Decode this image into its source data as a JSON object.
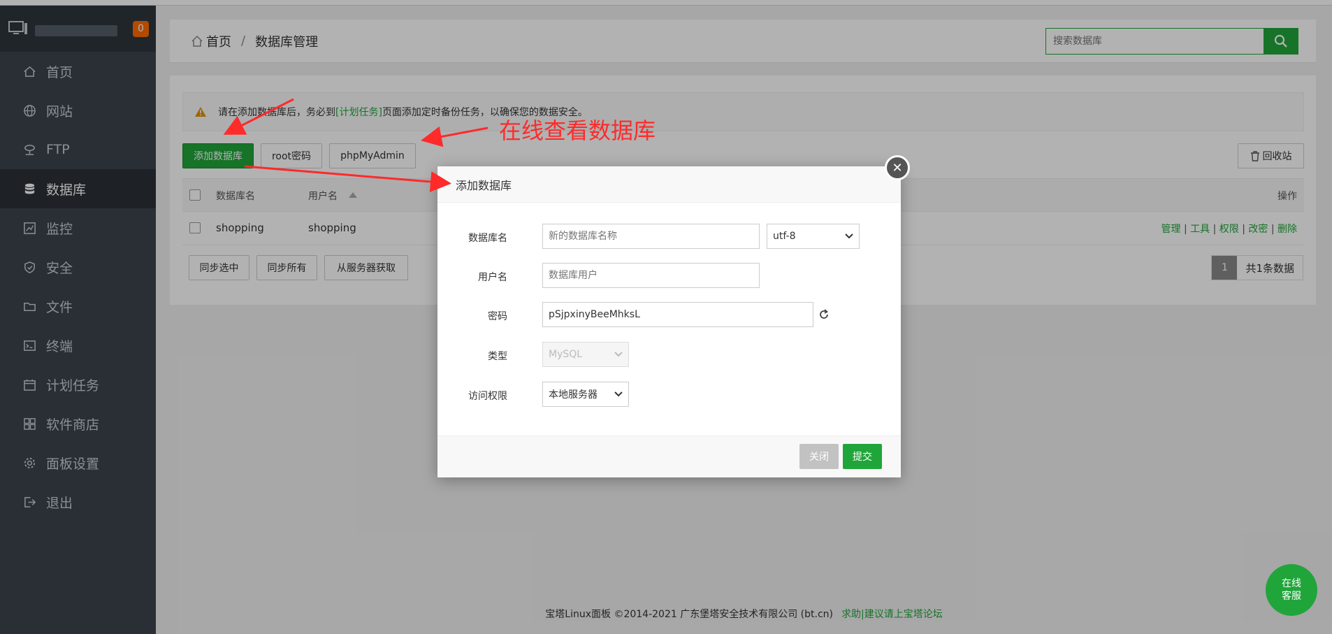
{
  "sidebar": {
    "badge": "0",
    "items": [
      {
        "label": "首页",
        "icon": "home-icon"
      },
      {
        "label": "网站",
        "icon": "globe-icon"
      },
      {
        "label": "FTP",
        "icon": "ftp-icon"
      },
      {
        "label": "数据库",
        "icon": "database-icon"
      },
      {
        "label": "监控",
        "icon": "monitor-chart-icon"
      },
      {
        "label": "安全",
        "icon": "shield-icon"
      },
      {
        "label": "文件",
        "icon": "folder-icon"
      },
      {
        "label": "终端",
        "icon": "terminal-icon"
      },
      {
        "label": "计划任务",
        "icon": "calendar-icon"
      },
      {
        "label": "软件商店",
        "icon": "grid-icon"
      },
      {
        "label": "面板设置",
        "icon": "gear-icon"
      },
      {
        "label": "退出",
        "icon": "logout-icon"
      }
    ]
  },
  "breadcrumb": {
    "home": "首页",
    "sep": "/",
    "current": "数据库管理"
  },
  "search": {
    "placeholder": "搜索数据库"
  },
  "notice": {
    "before": "请在添加数据库后，务必到",
    "link": "[计划任务]",
    "after": "页面添加定时备份任务，以确保您的数据安全。"
  },
  "toolbar": {
    "add_db": "添加数据库",
    "root_pwd": "root密码",
    "phpmyadmin": "phpMyAdmin",
    "recycle": "回收站"
  },
  "table": {
    "headers": {
      "name": "数据库名",
      "user": "用户名",
      "ops": "操作"
    },
    "rows": [
      {
        "name": "shopping",
        "user": "shopping"
      }
    ],
    "ops": [
      "管理",
      "工具",
      "权限",
      "改密",
      "删除"
    ]
  },
  "bottom": {
    "sync_selected": "同步选中",
    "sync_all": "同步所有",
    "from_server": "从服务器获取"
  },
  "pager": {
    "page": "1",
    "total": "共1条数据"
  },
  "footer": {
    "copyright": "宝塔Linux面板 ©2014-2021 广东堡塔安全技术有限公司 (bt.cn)",
    "link": "求助|建议请上宝塔论坛"
  },
  "chat": {
    "line1": "在线",
    "line2": "客服"
  },
  "annotation": "在线查看数据库",
  "modal": {
    "title": "添加数据库",
    "labels": {
      "name": "数据库名",
      "user": "用户名",
      "password": "密码",
      "type": "类型",
      "access": "访问权限"
    },
    "name_placeholder": "新的数据库名称",
    "charset": "utf-8",
    "user_placeholder": "数据库用户",
    "password": "pSjpxinyBeeMhksL",
    "type": "MySQL",
    "access": "本地服务器",
    "close": "关闭",
    "submit": "提交"
  },
  "colors": {
    "accent": "#20a53a",
    "badge": "#ff6c00",
    "annotation": "#ff2a2a",
    "sidebar": "#3c444d"
  }
}
